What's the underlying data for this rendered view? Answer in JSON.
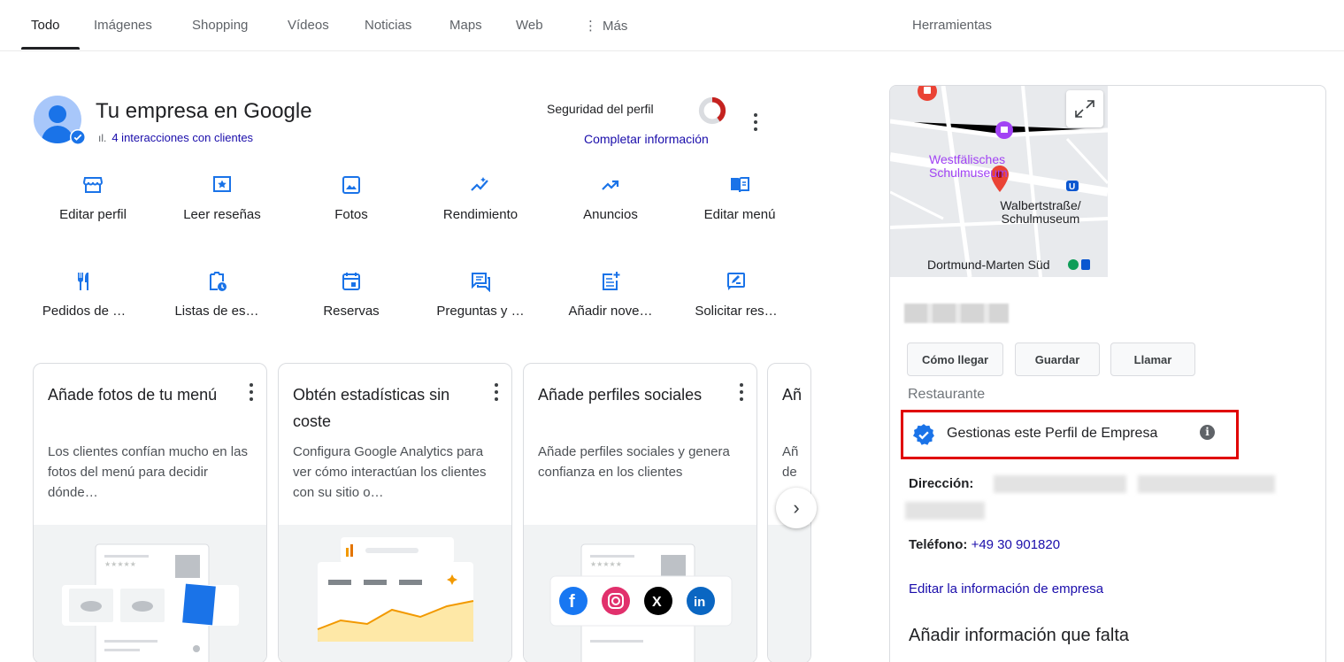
{
  "tabs": [
    {
      "label": "Todo",
      "active": true
    },
    {
      "label": "Imágenes"
    },
    {
      "label": "Shopping"
    },
    {
      "label": "Vídeos"
    },
    {
      "label": "Noticias"
    },
    {
      "label": "Maps"
    },
    {
      "label": "Web"
    },
    {
      "label": "Más",
      "icon": "more-vert-icon"
    }
  ],
  "tools_label": "Herramientas",
  "business": {
    "title": "Tu empresa en Google",
    "interactions": "4 interacciones con clientes",
    "security_label": "Seguridad del perfil",
    "security_progress": 0.4,
    "complete_link": "Completar información"
  },
  "actions": [
    {
      "label": "Editar perfil",
      "icon": "storefront-icon"
    },
    {
      "label": "Leer reseñas",
      "icon": "star-review-icon"
    },
    {
      "label": "Fotos",
      "icon": "photo-icon"
    },
    {
      "label": "Rendimiento",
      "icon": "insights-icon"
    },
    {
      "label": "Anuncios",
      "icon": "trending-up-icon"
    },
    {
      "label": "Editar menú",
      "icon": "menu-book-icon"
    },
    {
      "label": "Pedidos de …",
      "icon": "restaurant-icon"
    },
    {
      "label": "Listas de es…",
      "icon": "clipboard-clock-icon"
    },
    {
      "label": "Reservas",
      "icon": "calendar-icon"
    },
    {
      "label": "Preguntas y …",
      "icon": "question-answer-icon"
    },
    {
      "label": "Añadir nove…",
      "icon": "post-add-icon"
    },
    {
      "label": "Solicitar res…",
      "icon": "rate-review-icon"
    }
  ],
  "cards": [
    {
      "title": "Añade fotos de tu menú",
      "desc": "Los clientes confían mucho en las fotos del menú para decidir dónde…"
    },
    {
      "title": "Obtén estadísticas sin coste",
      "desc": "Configura Google Analytics para ver cómo interactúan los clientes con su sitio o…"
    },
    {
      "title": "Añade perfiles sociales",
      "desc": "Añade perfiles sociales y genera confianza en los clientes"
    },
    {
      "title": "Añ",
      "desc": "Añ de"
    }
  ],
  "panel": {
    "map_labels": {
      "museum": "Westfälisches Schulmuseum",
      "station": "Walbertstraße/ Schulmuseum",
      "sbahn": "Dortmund-Marten Süd"
    },
    "buttons": [
      "Cómo llegar",
      "Guardar",
      "Llamar"
    ],
    "category": "Restaurante",
    "manage_text": "Gestionas este Perfil de Empresa",
    "address_label": "Dirección:",
    "phone_label": "Teléfono:",
    "phone_value": "+49 30 901820",
    "edit_link": "Editar la información de empresa",
    "missing_heading": "Añadir información que falta"
  },
  "colors": {
    "link": "#1a0dab",
    "accent_blue": "#1a73e8",
    "highlight_red": "#e00000",
    "donut_red": "#c5221f"
  }
}
